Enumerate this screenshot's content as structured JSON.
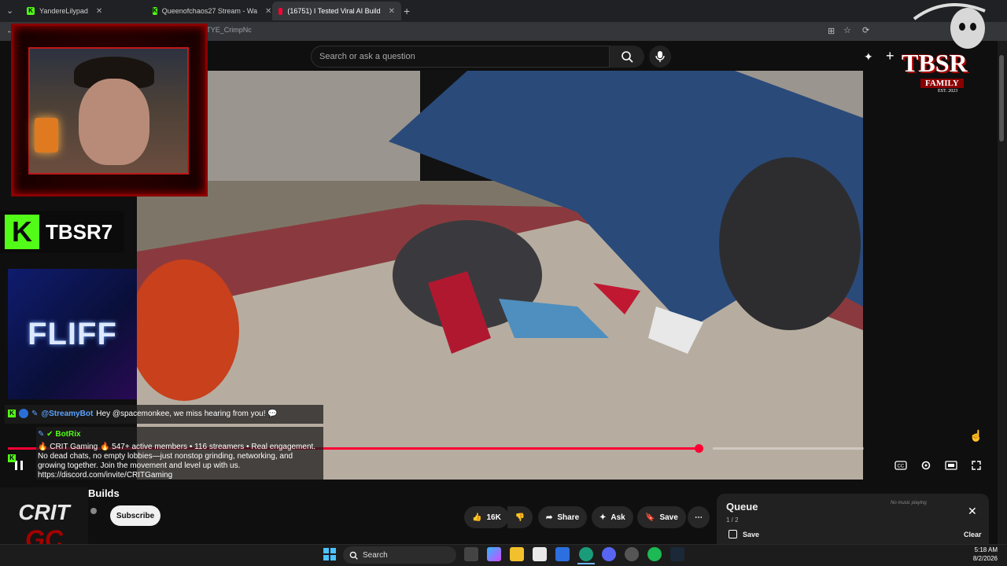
{
  "browser": {
    "tabs": [
      {
        "title": "YandereLilypad",
        "icon": "kick-favicon"
      },
      {
        "title": "Queenofchaos27 Stream - Wa",
        "icon": "kick-favicon"
      },
      {
        "title": "(16751) I Tested Viral AI Build",
        "icon": "youtube-favicon"
      }
    ],
    "url": "youtube.com/watch?v=TYE_CrimpNc"
  },
  "youtube": {
    "search_placeholder": "Search or ask a question",
    "video_title": "Builds",
    "subscribe_label": "Subscribe",
    "likes": "16K",
    "share_label": "Share",
    "ask_label": "Ask",
    "save_label": "Save",
    "progress": 0.88
  },
  "overlay": {
    "kick_username": "TBSR7",
    "sponsor": "FLIFF",
    "crit_logo_top": "CRIT",
    "crit_logo_bottom": "GC",
    "tbsr_logo": "TBSR",
    "tbsr_family": "FAMILY",
    "tbsr_est": "EST. 2023",
    "chat": [
      {
        "user": "@StreamyBot",
        "message": "Hey @spacemonkee, we miss hearing from you! 💬"
      },
      {
        "user": "BotRix",
        "message": "🔥 CRIT Gaming 🔥 547+ active members • 116 streamers • Real engagement. No dead chats, no empty lobbies—just nonstop grinding, networking, and growing together. Join the movement and level up with us. https://discord.com/invite/CRITGaming"
      }
    ]
  },
  "queue": {
    "title": "Queue",
    "count": "1 / 2",
    "save_label": "Save",
    "clear_label": "Clear",
    "no_music": "No music playing"
  },
  "taskbar": {
    "search_label": "Search",
    "time": "5:18 AM",
    "date": "8/2/2026"
  },
  "colors": {
    "accent_red": "#ff0033",
    "kick_green": "#53fc18"
  }
}
